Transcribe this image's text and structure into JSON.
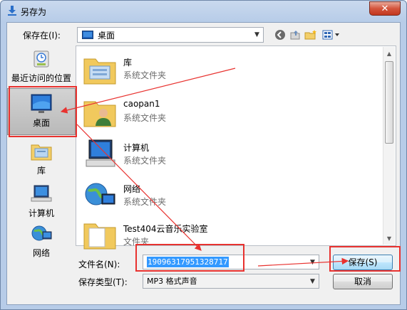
{
  "window": {
    "title": "另存为",
    "close_label": "✕"
  },
  "toolbar": {
    "save_in_label": "保存在(I):",
    "location": "桌面"
  },
  "places": [
    {
      "label": "最近访问的位置"
    },
    {
      "label": "桌面"
    },
    {
      "label": "库"
    },
    {
      "label": "计算机"
    },
    {
      "label": "网络"
    }
  ],
  "files": [
    {
      "name": "库",
      "type": "系统文件夹"
    },
    {
      "name": "caopan1",
      "type": "系统文件夹"
    },
    {
      "name": "计算机",
      "type": "系统文件夹"
    },
    {
      "name": "网络",
      "type": "系统文件夹"
    },
    {
      "name": "Test404云音乐实验室",
      "type": "文件夹"
    }
  ],
  "form": {
    "filename_label": "文件名(N):",
    "filename_value": "19096317951328717",
    "filetype_label": "保存类型(T):",
    "filetype_value": "MP3 格式声音"
  },
  "buttons": {
    "save": "保存(S)",
    "cancel": "取消"
  },
  "colors": {
    "annotation": "#e8322f",
    "selection": "#3399ff"
  }
}
